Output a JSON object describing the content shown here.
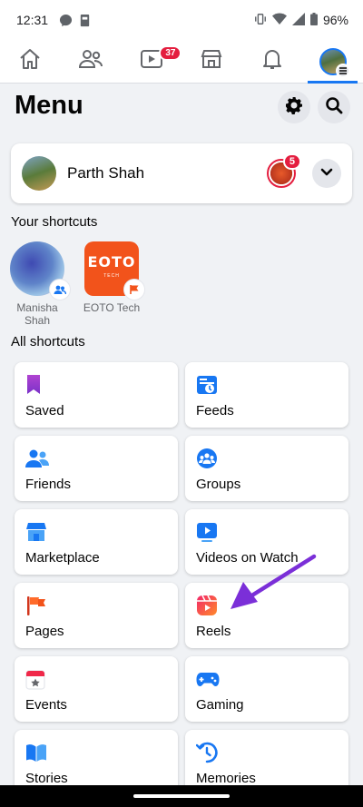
{
  "status_bar": {
    "time": "12:31",
    "battery": "96%"
  },
  "top_nav": {
    "items": [
      {
        "name": "home",
        "icon": "home-icon"
      },
      {
        "name": "friends",
        "icon": "friends-icon"
      },
      {
        "name": "watch",
        "icon": "watch-icon",
        "badge": "37"
      },
      {
        "name": "marketplace",
        "icon": "marketplace-icon"
      },
      {
        "name": "notifications",
        "icon": "bell-icon"
      },
      {
        "name": "menu",
        "icon": "profile-menu-icon",
        "active": true
      }
    ]
  },
  "header": {
    "title": "Menu"
  },
  "profile": {
    "name": "Parth Shah",
    "story_badge": "5"
  },
  "your_shortcuts": {
    "label": "Your shortcuts",
    "items": [
      {
        "label": "Manisha Shah",
        "line1": "Manisha",
        "line2": "Shah"
      },
      {
        "label": "EOTO Tech",
        "logo_text": "EOTO",
        "logo_sub": "TECH"
      }
    ]
  },
  "all_shortcuts": {
    "label": "All shortcuts",
    "items": [
      {
        "label": "Saved",
        "icon": "bookmark-icon"
      },
      {
        "label": "Feeds",
        "icon": "feeds-icon"
      },
      {
        "label": "Friends",
        "icon": "friends-icon"
      },
      {
        "label": "Groups",
        "icon": "groups-icon"
      },
      {
        "label": "Marketplace",
        "icon": "marketplace-icon"
      },
      {
        "label": "Videos on Watch",
        "icon": "watch-icon"
      },
      {
        "label": "Pages",
        "icon": "flag-icon"
      },
      {
        "label": "Reels",
        "icon": "reels-icon"
      },
      {
        "label": "Events",
        "icon": "calendar-icon"
      },
      {
        "label": "Gaming",
        "icon": "gamepad-icon"
      },
      {
        "label": "Stories",
        "icon": "book-icon"
      },
      {
        "label": "Memories",
        "icon": "clock-icon"
      }
    ]
  },
  "colors": {
    "accent": "#1877f2",
    "badge": "#e41e3f",
    "arrow": "#7b2fd8",
    "background": "#f0f2f5"
  }
}
